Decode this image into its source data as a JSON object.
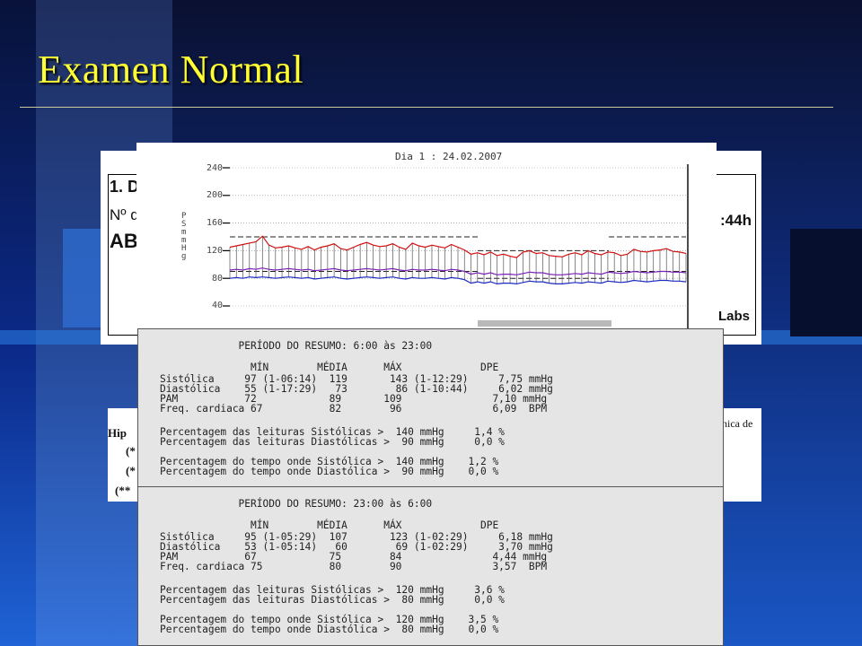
{
  "slide": {
    "title": "Examen Normal"
  },
  "background_doc": {
    "fragments": [
      "1. D",
      "Nº d",
      "ABI",
      ":44h",
      "Labs"
    ],
    "fragments_lower": [
      "Hip",
      "(*",
      "(*",
      "(**",
      "nica de"
    ]
  },
  "chart": {
    "title": "Dia 1 : 24.02.2007",
    "y_unit": "PS mmHg",
    "y_ticks": [
      "240",
      "200",
      "160",
      "120",
      "80",
      "40"
    ]
  },
  "chart_data": {
    "type": "line",
    "title": "Dia 1 : 24.02.2007",
    "ylabel": "PS mmHg",
    "ylim": [
      40,
      240
    ],
    "series": [
      {
        "name": "",
        "color": "#d01010",
        "values": [
          125,
          127,
          129,
          131,
          133,
          141,
          128,
          124,
          125,
          127,
          124,
          122,
          126,
          121,
          125,
          127,
          130,
          123,
          121,
          125,
          129,
          132,
          128,
          126,
          127,
          130,
          125,
          122,
          131,
          127,
          125,
          128,
          126,
          124,
          129,
          125,
          121,
          115,
          117,
          114,
          118,
          113,
          115,
          112,
          110,
          118,
          120,
          116,
          117,
          113,
          112,
          111,
          115,
          117,
          114,
          120,
          116,
          114,
          118,
          117,
          113,
          115,
          122,
          119,
          118,
          120,
          121,
          123,
          119,
          118,
          116
        ]
      },
      {
        "name": "",
        "color": "#7a22b8",
        "values": [
          92,
          93,
          92,
          94,
          93,
          95,
          93,
          92,
          93,
          94,
          93,
          92,
          93,
          91,
          92,
          93,
          94,
          92,
          91,
          92,
          93,
          94,
          93,
          92,
          93,
          94,
          92,
          91,
          93,
          92,
          92,
          93,
          92,
          91,
          93,
          92,
          90,
          86,
          88,
          86,
          88,
          85,
          86,
          86,
          85,
          87,
          89,
          88,
          88,
          86,
          85,
          85,
          86,
          87,
          86,
          88,
          87,
          86,
          89,
          88,
          87,
          88,
          90,
          89,
          88,
          89,
          90,
          90,
          89,
          89,
          88
        ]
      },
      {
        "name": "",
        "color": "#1a2ac0",
        "values": [
          80,
          81,
          80,
          82,
          81,
          82,
          81,
          80,
          81,
          82,
          81,
          80,
          81,
          79,
          80,
          81,
          82,
          80,
          79,
          80,
          81,
          82,
          81,
          80,
          81,
          82,
          80,
          79,
          81,
          80,
          80,
          81,
          80,
          79,
          81,
          80,
          78,
          73,
          75,
          73,
          75,
          72,
          73,
          73,
          72,
          74,
          76,
          75,
          75,
          73,
          72,
          72,
          73,
          74,
          73,
          75,
          74,
          73,
          76,
          75,
          74,
          75,
          77,
          76,
          75,
          76,
          77,
          77,
          76,
          76,
          75
        ]
      }
    ]
  },
  "summary_day": {
    "lines": [
      "             PERÍODO DO RESUMO: 6:00 às 23:00",
      "",
      "               MÍN        MÉDIA      MÁX             DPE",
      "Sistólica     97 (1-06:14)  119       143 (1-12:29)     7,75 mmHg",
      "Diastólica    55 (1-17:29)   73        86 (1-10:44)     6,02 mmHg",
      "PAM           72            89       109               7,10 mmHg",
      "Freq. cardiaca 67           82        96               6,09  BPM",
      "",
      "Percentagem das leituras Sistólicas >  140 mmHg     1,4 %",
      "Percentagem das leituras Diastólicas >  90 mmHg     0,0 %",
      "",
      "Percentagem do tempo onde Sistólica >  140 mmHg    1,2 %",
      "Percentagem do tempo onde Diastólica >  90 mmHg    0,0 %"
    ]
  },
  "summary_night": {
    "lines": [
      "             PERÍODO DO RESUMO: 23:00 às 6:00",
      "",
      "               MÍN        MÉDIA      MÁX             DPE",
      "Sistólica     95 (1-05:29)  107       123 (1-02:29)     6,18 mmHg",
      "Diastólica    53 (1-05:14)   60        69 (1-02:29)     3,70 mmHg",
      "PAM           67            75        84               4,44 mmHg",
      "Freq. cardiaca 75           80        90               3,57  BPM",
      "",
      "Percentagem das leituras Sistólicas >  120 mmHg     3,6 %",
      "Percentagem das leituras Diastólicas >  80 mmHg     0,0 %",
      "",
      "Percentagem do tempo onde Sistólica >  120 mmHg    3,5 %",
      "Percentagem do tempo onde Diastólica >  80 mmHg    0,0 %"
    ]
  }
}
